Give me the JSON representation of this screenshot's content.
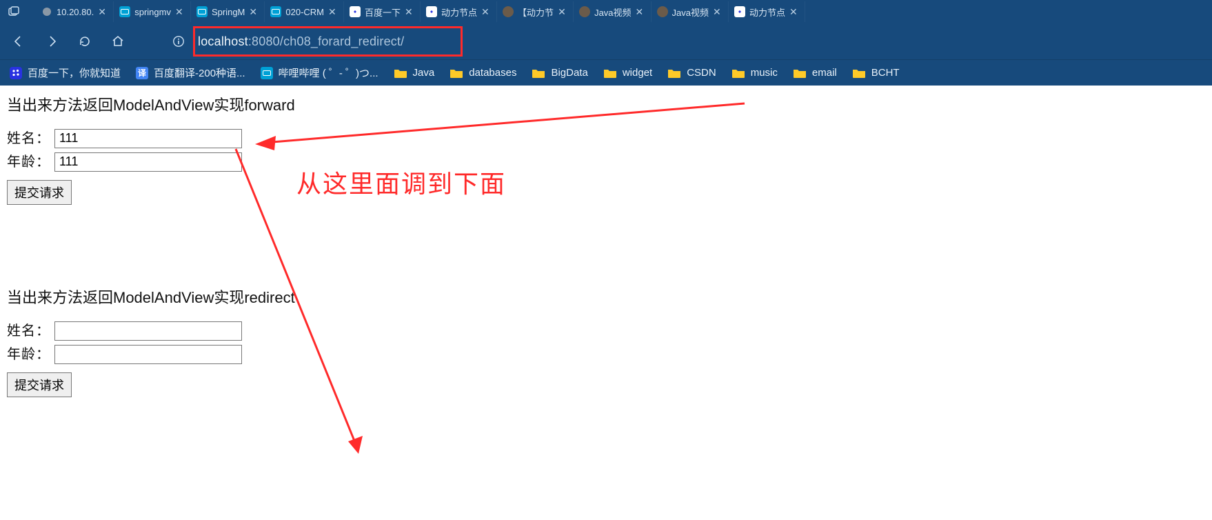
{
  "browser": {
    "tabs": [
      {
        "title": "10.20.80.",
        "icon": "lock-grey"
      },
      {
        "title": "springmv",
        "icon": "bili"
      },
      {
        "title": "SpringM",
        "icon": "bili"
      },
      {
        "title": "020-CRM",
        "icon": "bili"
      },
      {
        "title": "百度一下",
        "icon": "baidu"
      },
      {
        "title": "动力节点",
        "icon": "baidu"
      },
      {
        "title": "【动力节",
        "icon": "csdn"
      },
      {
        "title": "Java视频",
        "icon": "csdn"
      },
      {
        "title": "Java视频",
        "icon": "csdn"
      },
      {
        "title": "动力节点",
        "icon": "baidu"
      }
    ],
    "url": {
      "host": "localhost",
      "port_path": ":8080/ch08_forard_redirect/"
    },
    "bookmarks": [
      {
        "label": "百度一下，你就知道",
        "icon": "baidu-bm"
      },
      {
        "label": "百度翻译-200种语...",
        "icon": "trans"
      },
      {
        "label": "哔哩哔哩 ( ゜- ゜)つ...",
        "icon": "bili"
      },
      {
        "label": "Java",
        "icon": "folder"
      },
      {
        "label": "databases",
        "icon": "folder"
      },
      {
        "label": "BigData",
        "icon": "folder"
      },
      {
        "label": "widget",
        "icon": "folder"
      },
      {
        "label": "CSDN",
        "icon": "folder"
      },
      {
        "label": "music",
        "icon": "folder"
      },
      {
        "label": "email",
        "icon": "folder"
      },
      {
        "label": "BCHT",
        "icon": "folder"
      }
    ]
  },
  "page": {
    "section1": {
      "heading": "当出来方法返回ModelAndView实现forward",
      "name_label": "姓名：",
      "name_value": "111",
      "age_label": "年龄：",
      "age_value": "111",
      "submit": "提交请求"
    },
    "section2": {
      "heading": "当出来方法返回ModelAndView实现redirect",
      "name_label": "姓名：",
      "name_value": "",
      "age_label": "年龄：",
      "age_value": "",
      "submit": "提交请求"
    },
    "annotation": "从这里面调到下面"
  }
}
